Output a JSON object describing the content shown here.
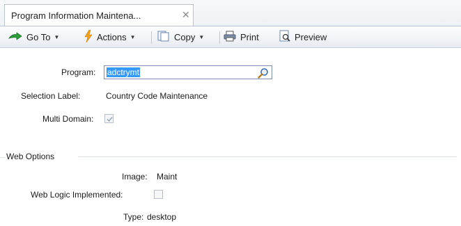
{
  "tab": {
    "title": "Program Information Maintena...",
    "close": "✕"
  },
  "toolbar": {
    "goto_label": "Go To",
    "actions_label": "Actions",
    "copy_label": "Copy",
    "print_label": "Print",
    "preview_label": "Preview"
  },
  "form": {
    "program_label": "Program:",
    "program_value": "adctrymt",
    "selection_label": "Selection Label:",
    "selection_value": "Country Code Maintenance",
    "multi_domain_label": "Multi Domain:",
    "multi_domain_checked": true
  },
  "web_options": {
    "title": "Web Options",
    "image_label": "Image:",
    "image_value": "Maint",
    "web_logic_label": "Web Logic Implemented:",
    "web_logic_checked": false,
    "type_label": "Type:",
    "type_value": "desktop"
  },
  "colors": {
    "selection": "#3399ff",
    "border": "#b9c2cf"
  }
}
